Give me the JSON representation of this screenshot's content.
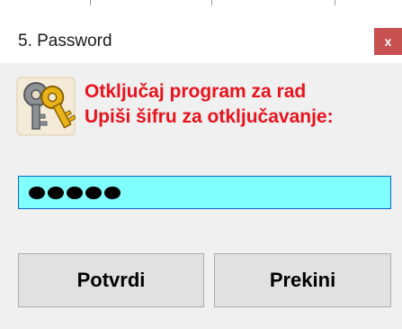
{
  "window": {
    "title": "5. Password",
    "close_label": "x"
  },
  "dialog": {
    "icon": "keys-icon",
    "line1": "Otključaj program za rad",
    "line2": "Upiši šifru za otključavanje:",
    "message_color": "#e8131d"
  },
  "password": {
    "masked_length": 5,
    "field_color": "#80ffff"
  },
  "buttons": {
    "ok_label": "Potvrdi",
    "cancel_label": "Prekini"
  }
}
